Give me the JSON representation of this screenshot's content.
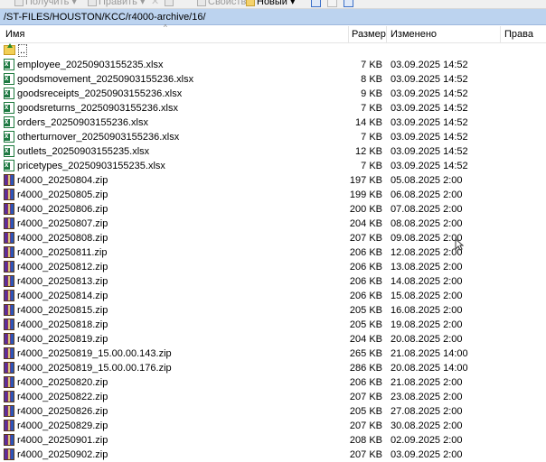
{
  "toolbar": {
    "download_label": "Получить",
    "edit_label": "Править",
    "properties_label": "Свойства",
    "new_label": "Новый"
  },
  "path": "/ST-FILES/HOUSTON/KCC/r4000-archive/16/",
  "columns": {
    "name": "Имя",
    "size": "Размер",
    "modified": "Изменено",
    "rights": "Права"
  },
  "parent": {
    "label": ".."
  },
  "files": [
    {
      "name": "employee_20250903155235.xlsx",
      "size": "7 KB",
      "modified": "03.09.2025 14:52",
      "icon": "excel-icon"
    },
    {
      "name": "goodsmovement_20250903155236.xlsx",
      "size": "8 KB",
      "modified": "03.09.2025 14:52",
      "icon": "excel-icon"
    },
    {
      "name": "goodsreceipts_20250903155236.xlsx",
      "size": "9 KB",
      "modified": "03.09.2025 14:52",
      "icon": "excel-icon"
    },
    {
      "name": "goodsreturns_20250903155236.xlsx",
      "size": "7 KB",
      "modified": "03.09.2025 14:52",
      "icon": "excel-icon"
    },
    {
      "name": "orders_20250903155236.xlsx",
      "size": "14 KB",
      "modified": "03.09.2025 14:52",
      "icon": "excel-icon"
    },
    {
      "name": "otherturnover_20250903155236.xlsx",
      "size": "7 KB",
      "modified": "03.09.2025 14:52",
      "icon": "excel-icon"
    },
    {
      "name": "outlets_20250903155235.xlsx",
      "size": "12 KB",
      "modified": "03.09.2025 14:52",
      "icon": "excel-icon"
    },
    {
      "name": "pricetypes_20250903155235.xlsx",
      "size": "7 KB",
      "modified": "03.09.2025 14:52",
      "icon": "excel-icon"
    },
    {
      "name": "r4000_20250804.zip",
      "size": "197 KB",
      "modified": "05.08.2025 2:00",
      "icon": "archive-icon"
    },
    {
      "name": "r4000_20250805.zip",
      "size": "199 KB",
      "modified": "06.08.2025 2:00",
      "icon": "archive-icon"
    },
    {
      "name": "r4000_20250806.zip",
      "size": "200 KB",
      "modified": "07.08.2025 2:00",
      "icon": "archive-icon"
    },
    {
      "name": "r4000_20250807.zip",
      "size": "204 KB",
      "modified": "08.08.2025 2:00",
      "icon": "archive-icon"
    },
    {
      "name": "r4000_20250808.zip",
      "size": "207 KB",
      "modified": "09.08.2025 2:00",
      "icon": "archive-icon"
    },
    {
      "name": "r4000_20250811.zip",
      "size": "206 KB",
      "modified": "12.08.2025 2:00",
      "icon": "archive-icon"
    },
    {
      "name": "r4000_20250812.zip",
      "size": "206 KB",
      "modified": "13.08.2025 2:00",
      "icon": "archive-icon"
    },
    {
      "name": "r4000_20250813.zip",
      "size": "206 KB",
      "modified": "14.08.2025 2:00",
      "icon": "archive-icon"
    },
    {
      "name": "r4000_20250814.zip",
      "size": "206 KB",
      "modified": "15.08.2025 2:00",
      "icon": "archive-icon"
    },
    {
      "name": "r4000_20250815.zip",
      "size": "205 KB",
      "modified": "16.08.2025 2:00",
      "icon": "archive-icon"
    },
    {
      "name": "r4000_20250818.zip",
      "size": "205 KB",
      "modified": "19.08.2025 2:00",
      "icon": "archive-icon"
    },
    {
      "name": "r4000_20250819.zip",
      "size": "204 KB",
      "modified": "20.08.2025 2:00",
      "icon": "archive-icon"
    },
    {
      "name": "r4000_20250819_15.00.00.143.zip",
      "size": "265 KB",
      "modified": "21.08.2025 14:00",
      "icon": "archive-icon"
    },
    {
      "name": "r4000_20250819_15.00.00.176.zip",
      "size": "286 KB",
      "modified": "20.08.2025 14:00",
      "icon": "archive-icon"
    },
    {
      "name": "r4000_20250820.zip",
      "size": "206 KB",
      "modified": "21.08.2025 2:00",
      "icon": "archive-icon"
    },
    {
      "name": "r4000_20250822.zip",
      "size": "207 KB",
      "modified": "23.08.2025 2:00",
      "icon": "archive-icon"
    },
    {
      "name": "r4000_20250826.zip",
      "size": "205 KB",
      "modified": "27.08.2025 2:00",
      "icon": "archive-icon"
    },
    {
      "name": "r4000_20250829.zip",
      "size": "207 KB",
      "modified": "30.08.2025 2:00",
      "icon": "archive-icon"
    },
    {
      "name": "r4000_20250901.zip",
      "size": "208 KB",
      "modified": "02.09.2025 2:00",
      "icon": "archive-icon"
    },
    {
      "name": "r4000_20250902.zip",
      "size": "207 KB",
      "modified": "03.09.2025 2:00",
      "icon": "archive-icon"
    }
  ],
  "colors": {
    "path_bar_bg": "#bcd3ef",
    "excel_green": "#1f7a43",
    "folder_yellow": "#f2cf56"
  }
}
